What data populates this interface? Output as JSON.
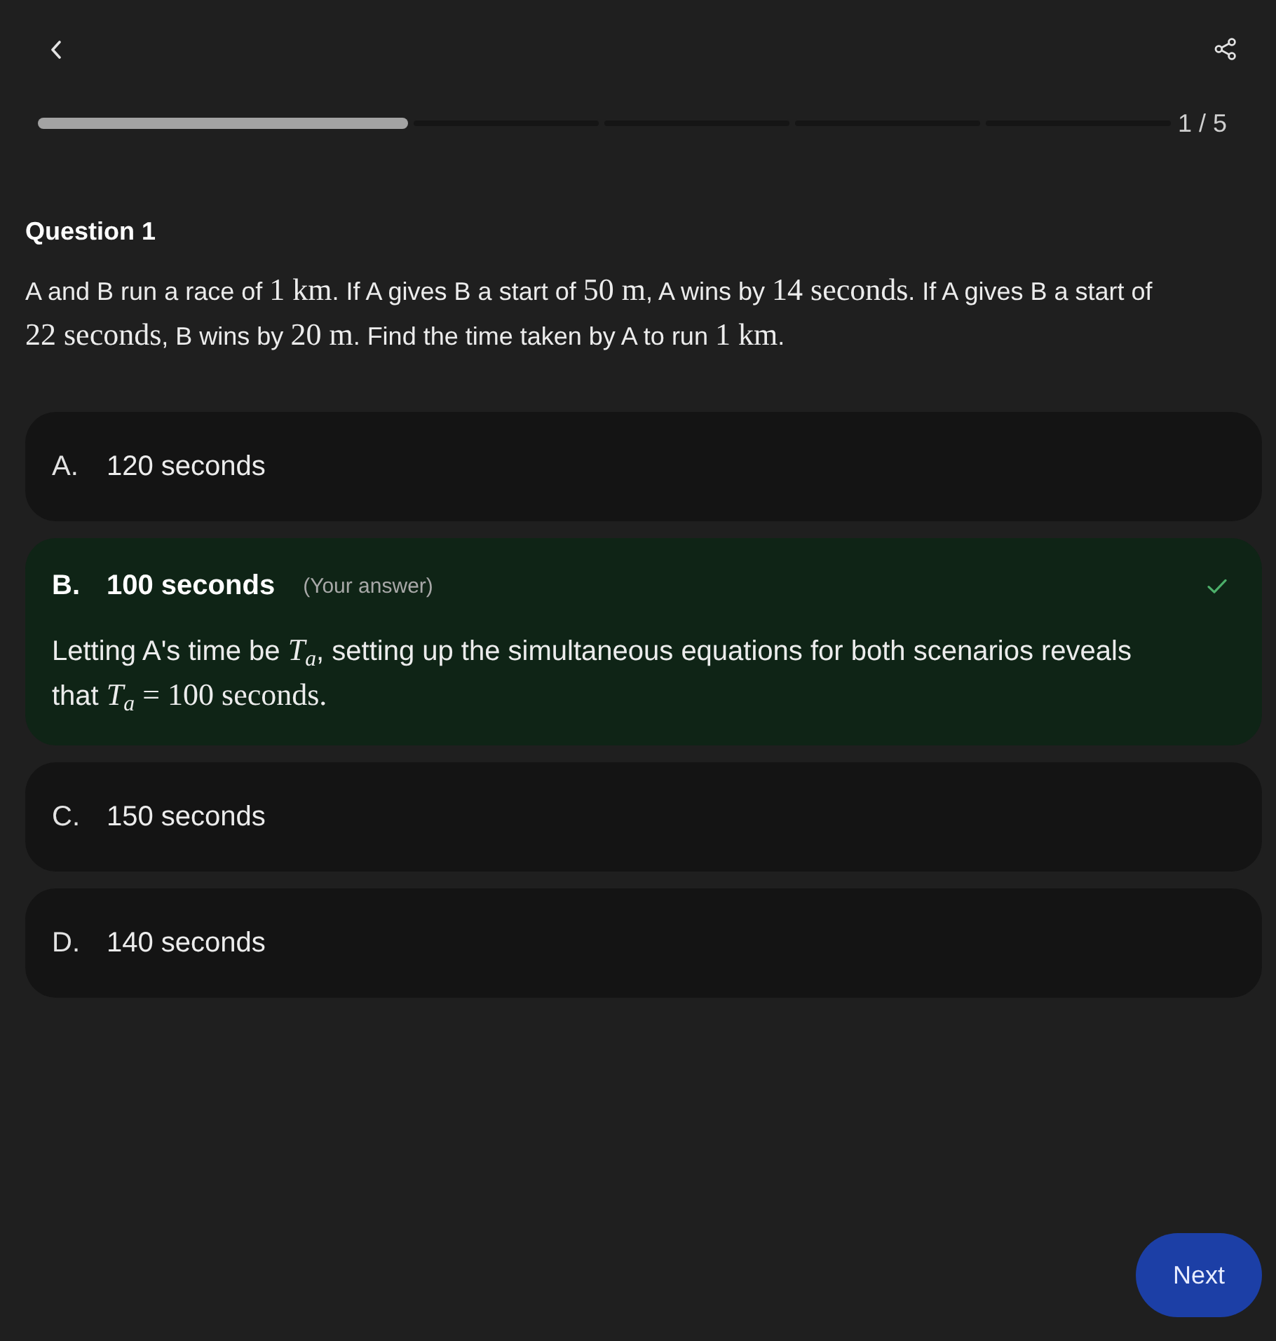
{
  "header": {
    "progress": {
      "segments": [
        {
          "current": true
        },
        {
          "current": false
        },
        {
          "current": false
        },
        {
          "current": false
        },
        {
          "current": false
        }
      ],
      "counter": "1 / 5"
    }
  },
  "question": {
    "title": "Question 1",
    "parts": [
      {
        "kind": "text",
        "text": "A and B run a race of "
      },
      {
        "kind": "math",
        "text": "1 km"
      },
      {
        "kind": "text",
        "text": ". If A gives B a start of "
      },
      {
        "kind": "math",
        "text": "50 m"
      },
      {
        "kind": "text",
        "text": ", A wins by "
      },
      {
        "kind": "math",
        "text": "14 seconds"
      },
      {
        "kind": "text",
        "text": ". If A gives B a start of "
      },
      {
        "kind": "math",
        "text": "22 seconds"
      },
      {
        "kind": "text",
        "text": ", B wins by "
      },
      {
        "kind": "math",
        "text": "20 m"
      },
      {
        "kind": "text",
        "text": ". Find the time taken by A to run "
      },
      {
        "kind": "math",
        "text": "1 km"
      },
      {
        "kind": "text",
        "text": "."
      }
    ]
  },
  "options": [
    {
      "letter": "A.",
      "text": "120 seconds",
      "selected": false
    },
    {
      "letter": "B.",
      "text": "100 seconds",
      "selected": true,
      "note": "(Your answer)",
      "explanation": [
        {
          "kind": "text",
          "text": "Letting A's time be "
        },
        {
          "kind": "math",
          "text": "*T*$_{a}$"
        },
        {
          "kind": "text",
          "text": ", setting up the simultaneous equations for both scenarios reveals that "
        },
        {
          "kind": "math",
          "text": "*T*$_{a}$ = 100 seconds."
        }
      ]
    },
    {
      "letter": "C.",
      "text": "150 seconds",
      "selected": false
    },
    {
      "letter": "D.",
      "text": "140 seconds",
      "selected": false
    }
  ],
  "next_button": {
    "label": "Next"
  }
}
